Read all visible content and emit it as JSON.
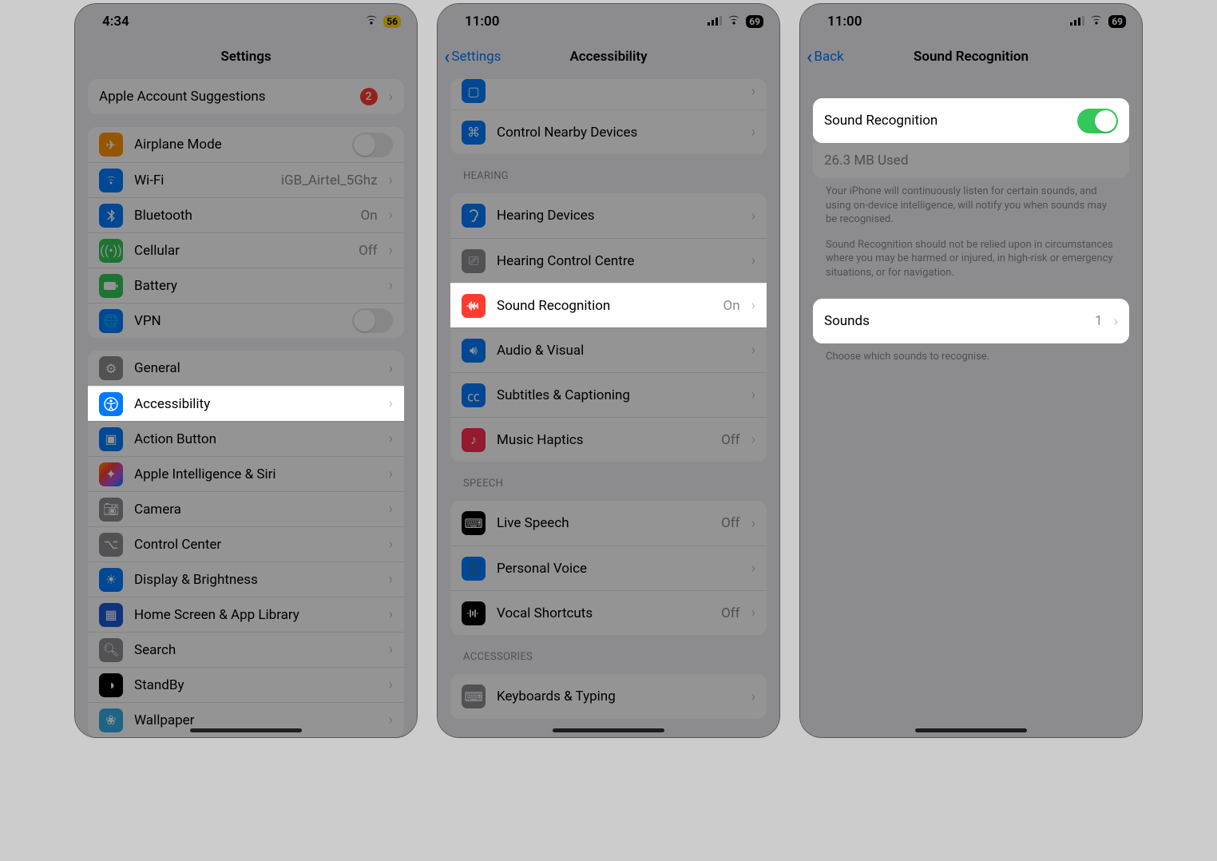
{
  "phone1": {
    "time": "4:34",
    "battery": "56",
    "title": "Settings",
    "suggestion": {
      "label": "Apple Account Suggestions",
      "badge": "2"
    },
    "net": {
      "airplane": "Airplane Mode",
      "wifi": "Wi-Fi",
      "wifi_val": "iGB_Airtel_5Ghz",
      "bt": "Bluetooth",
      "bt_val": "On",
      "cell": "Cellular",
      "cell_val": "Off",
      "batt": "Battery",
      "vpn": "VPN"
    },
    "gen": {
      "general": "General",
      "accessibility": "Accessibility",
      "action": "Action Button",
      "ai": "Apple Intelligence & Siri",
      "camera": "Camera",
      "cc": "Control Center",
      "display": "Display & Brightness",
      "home": "Home Screen & App Library",
      "search": "Search",
      "standby": "StandBy",
      "wallpaper": "Wallpaper"
    }
  },
  "phone2": {
    "time": "11:00",
    "battery": "69",
    "back": "Settings",
    "title": "Accessibility",
    "items": {
      "control_nearby": "Control Nearby Devices",
      "h_header": "HEARING",
      "hearing_devices": "Hearing Devices",
      "hearing_cc": "Hearing Control Centre",
      "sound_rec": "Sound Recognition",
      "sound_rec_val": "On",
      "audio_visual": "Audio & Visual",
      "subtitles": "Subtitles & Captioning",
      "music_haptics": "Music Haptics",
      "music_haptics_val": "Off",
      "s_header": "SPEECH",
      "live_speech": "Live Speech",
      "live_speech_val": "Off",
      "personal_voice": "Personal Voice",
      "vocal": "Vocal Shortcuts",
      "vocal_val": "Off",
      "a_header": "ACCESSORIES",
      "keyboards": "Keyboards & Typing"
    }
  },
  "phone3": {
    "time": "11:00",
    "battery": "69",
    "back": "Back",
    "title": "Sound Recognition",
    "toggle_label": "Sound Recognition",
    "storage": "26.3 MB Used",
    "footer1": "Your iPhone will continuously listen for certain sounds, and using on-device intelligence, will notify you when sounds may be recognised.",
    "footer2": "Sound Recognition should not be relied upon in circumstances where you may be harmed or injured, in high-risk or emergency situations, or for navigation.",
    "sounds_label": "Sounds",
    "sounds_val": "1",
    "footer3": "Choose which sounds to recognise."
  }
}
